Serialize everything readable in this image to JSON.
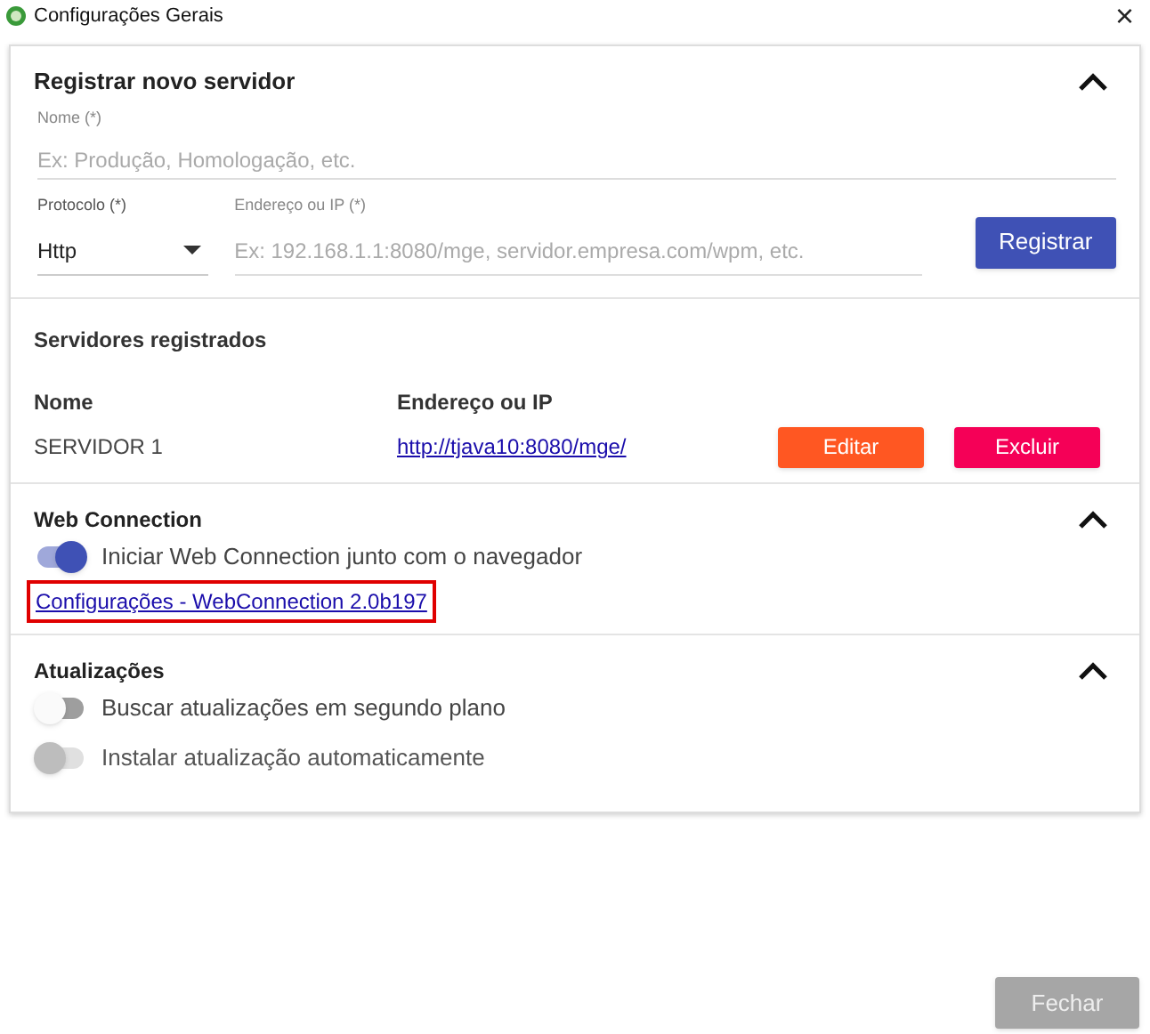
{
  "window": {
    "title": "Configurações Gerais",
    "close": "×"
  },
  "register": {
    "title": "Registrar novo servidor",
    "expanded": true,
    "name_field": {
      "label": "Nome (*)",
      "placeholder": "Ex: Produção, Homologação, etc."
    },
    "protocol_field": {
      "label": "Protocolo (*)",
      "value": "Http"
    },
    "address_field": {
      "label": "Endereço ou IP (*)",
      "placeholder": "Ex: 192.168.1.1:8080/mge, servidor.empresa.com/wpm, etc."
    },
    "button": "Registrar"
  },
  "servers": {
    "title": "Servidores registrados",
    "columns": [
      "Nome",
      "Endereço ou IP"
    ],
    "rows": [
      {
        "name": "SERVIDOR 1",
        "address": "http://tjava10:8080/mge/",
        "edit": "Editar",
        "delete": "Excluir"
      }
    ]
  },
  "web_connection": {
    "title": "Web Connection",
    "expanded": true,
    "toggles": [
      {
        "label": "Iniciar Web Connection junto com o navegador",
        "on": true,
        "disabled": false
      }
    ],
    "link": {
      "text": "Configurações - WebConnection 2.0b197",
      "highlighted": true
    }
  },
  "updates": {
    "title": "Atualizações",
    "expanded": true,
    "toggles": [
      {
        "label": "Buscar atualizações em segundo plano",
        "on": false,
        "disabled": false
      },
      {
        "label": "Instalar atualização automaticamente",
        "on": false,
        "disabled": true
      }
    ]
  },
  "footer": {
    "button": "Fechar",
    "disabled": true
  }
}
